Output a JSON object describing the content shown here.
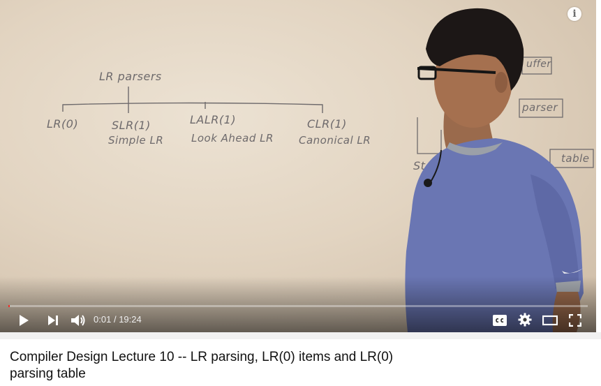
{
  "video": {
    "title": "Compiler Design Lecture 10 -- LR parsing, LR(0) items and LR(0) parsing table",
    "current_time": "0:01",
    "separator": "/",
    "duration": "19:24",
    "progress_fraction": 0.0
  },
  "whiteboard": {
    "root": "LR parsers",
    "parsers": [
      {
        "name": "LR(0)",
        "desc": ""
      },
      {
        "name": "SLR(1)",
        "desc": "Simple LR"
      },
      {
        "name": "LALR(1)",
        "desc": "Look Ahead LR"
      },
      {
        "name": "CLR(1)",
        "desc": "Canonical LR"
      }
    ],
    "partial_labels": {
      "buffer": "uffer",
      "parser": "parser",
      "table": "table",
      "stack": "St"
    }
  },
  "controls": {
    "info_icon": "info-icon",
    "play_icon": "play-icon",
    "next_icon": "next-icon",
    "volume_icon": "volume-icon",
    "captions_icon": "captions-icon",
    "settings_icon": "gear-icon",
    "theater_icon": "theater-mode-icon",
    "fullscreen_icon": "fullscreen-icon",
    "accent_color": "#f12b24"
  }
}
